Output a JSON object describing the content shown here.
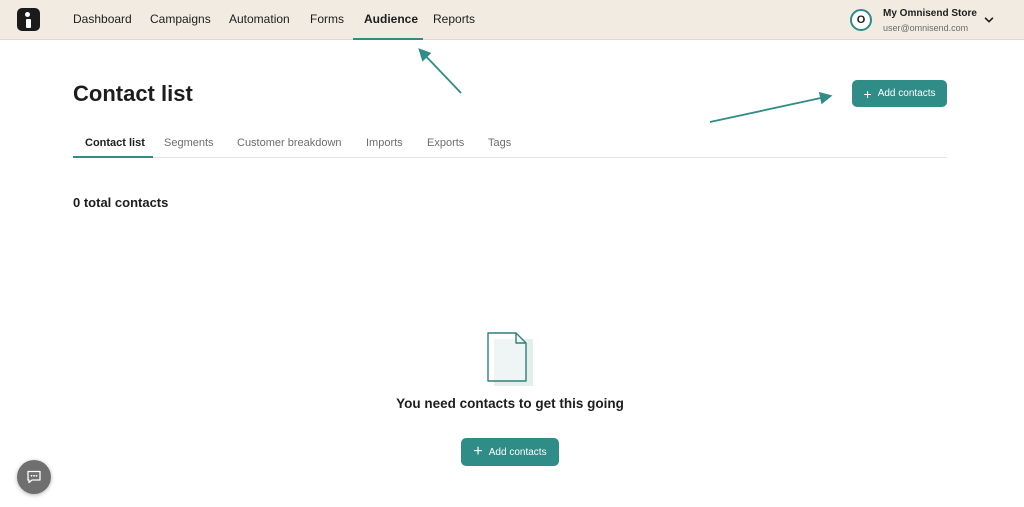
{
  "nav": {
    "items": [
      {
        "label": "Dashboard"
      },
      {
        "label": "Campaigns"
      },
      {
        "label": "Automation"
      },
      {
        "label": "Forms"
      },
      {
        "label": "Audience",
        "active": true
      },
      {
        "label": "Reports"
      }
    ]
  },
  "account": {
    "initial": "O",
    "store_name": "My Omnisend Store",
    "email": "user@omnisend.com"
  },
  "page": {
    "title": "Contact list",
    "add_button_label": "Add contacts"
  },
  "tabs": [
    {
      "label": "Contact list",
      "active": true
    },
    {
      "label": "Segments"
    },
    {
      "label": "Customer breakdown"
    },
    {
      "label": "Imports"
    },
    {
      "label": "Exports"
    },
    {
      "label": "Tags"
    }
  ],
  "summary": {
    "total_label": "0 total contacts"
  },
  "empty_state": {
    "message": "You need contacts to get this going",
    "button_label": "Add contacts"
  },
  "colors": {
    "accent": "#2f8c86",
    "topbar_bg": "#f2ebe2"
  }
}
